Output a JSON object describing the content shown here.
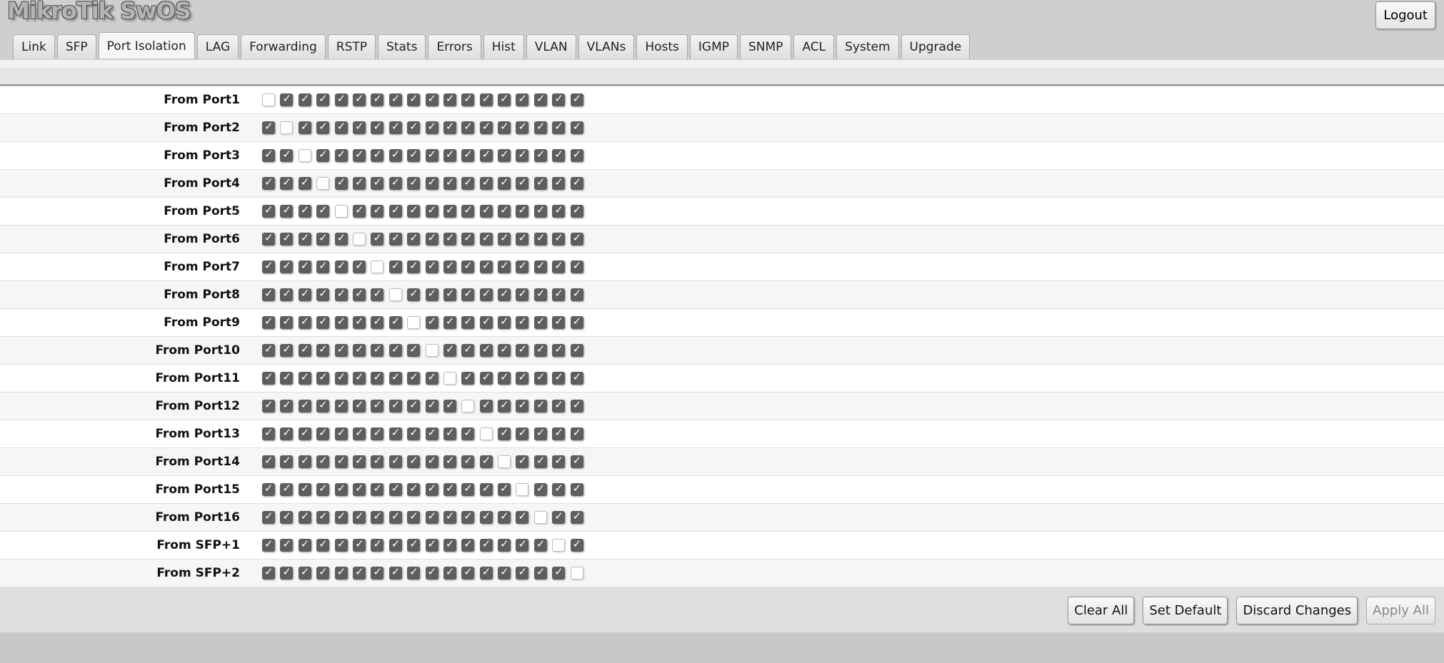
{
  "app": {
    "title": "MikroTik SwOS",
    "logout": "Logout"
  },
  "tabs": [
    "Link",
    "SFP",
    "Port Isolation",
    "LAG",
    "Forwarding",
    "RSTP",
    "Stats",
    "Errors",
    "Hist",
    "VLAN",
    "VLANs",
    "Hosts",
    "IGMP",
    "SNMP",
    "ACL",
    "System",
    "Upgrade"
  ],
  "active_tab": "Port Isolation",
  "rows": [
    {
      "label": "From Port1",
      "unchecked_column": 1
    },
    {
      "label": "From Port2",
      "unchecked_column": 2
    },
    {
      "label": "From Port3",
      "unchecked_column": 3
    },
    {
      "label": "From Port4",
      "unchecked_column": 4
    },
    {
      "label": "From Port5",
      "unchecked_column": 5
    },
    {
      "label": "From Port6",
      "unchecked_column": 6
    },
    {
      "label": "From Port7",
      "unchecked_column": 7
    },
    {
      "label": "From Port8",
      "unchecked_column": 8
    },
    {
      "label": "From Port9",
      "unchecked_column": 9
    },
    {
      "label": "From Port10",
      "unchecked_column": 10
    },
    {
      "label": "From Port11",
      "unchecked_column": 11
    },
    {
      "label": "From Port12",
      "unchecked_column": 12
    },
    {
      "label": "From Port13",
      "unchecked_column": 13
    },
    {
      "label": "From Port14",
      "unchecked_column": 14
    },
    {
      "label": "From Port15",
      "unchecked_column": 15
    },
    {
      "label": "From Port16",
      "unchecked_column": 16
    },
    {
      "label": "From SFP+1",
      "unchecked_column": 17
    },
    {
      "label": "From SFP+2",
      "unchecked_column": 18
    }
  ],
  "columns": 18,
  "footer": {
    "clear_all": "Clear All",
    "set_default": "Set Default",
    "discard": "Discard Changes",
    "apply_all": "Apply All"
  }
}
